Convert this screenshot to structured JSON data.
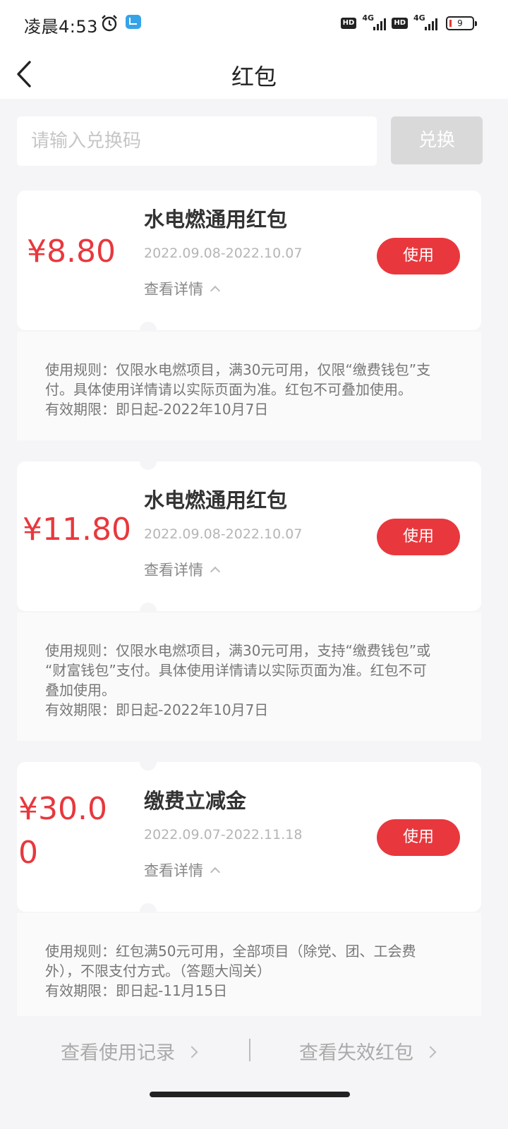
{
  "status_bar": {
    "time": "凌晨4:53",
    "net_badge_1": "HD",
    "net_gen_1": "4G",
    "net_badge_2": "HD",
    "net_gen_2": "4G",
    "battery_level": "9"
  },
  "header": {
    "title": "红包"
  },
  "redeem": {
    "placeholder": "请输入兑换码",
    "button_label": "兑换"
  },
  "coupons": [
    {
      "amount": "¥8.80",
      "title": "水电燃通用红包",
      "date_range": "2022.09.08-2022.10.07",
      "detail_label": "查看详情",
      "use_label": "使用",
      "rule_lines": [
        "使用规则：仅限水电燃项目，满30元可用，仅限“缴费钱包”支",
        "付。具体使用详情请以实际页面为准。红包不可叠加使用。"
      ],
      "validity": "有效期限：即日起-2022年10月7日"
    },
    {
      "amount": "¥11.80",
      "title": "水电燃通用红包",
      "date_range": "2022.09.08-2022.10.07",
      "detail_label": "查看详情",
      "use_label": "使用",
      "rule_lines": [
        "使用规则：仅限水电燃项目，满30元可用，支持“缴费钱包”或",
        "“财富钱包”支付。具体使用详情请以实际页面为准。红包不可",
        "叠加使用。"
      ],
      "validity": "有效期限：即日起-2022年10月7日"
    },
    {
      "amount_line1": "¥30.0",
      "amount_line2": "0",
      "title": "缴费立减金",
      "date_range": "2022.09.07-2022.11.18",
      "detail_label": "查看详情",
      "use_label": "使用",
      "rule_lines": [
        "使用规则：红包满50元可用，全部项目（除党、团、工会费",
        "外），不限支付方式。（答题大闯关）"
      ],
      "validity": "有效期限：即日起-11月15日"
    }
  ],
  "footer": {
    "usage_record_label": "查看使用记录",
    "expired_label": "查看失效红包"
  },
  "colors": {
    "accent": "#e8383d",
    "page_bg": "#f5f5f7",
    "disabled_button": "#d9d9d9"
  }
}
